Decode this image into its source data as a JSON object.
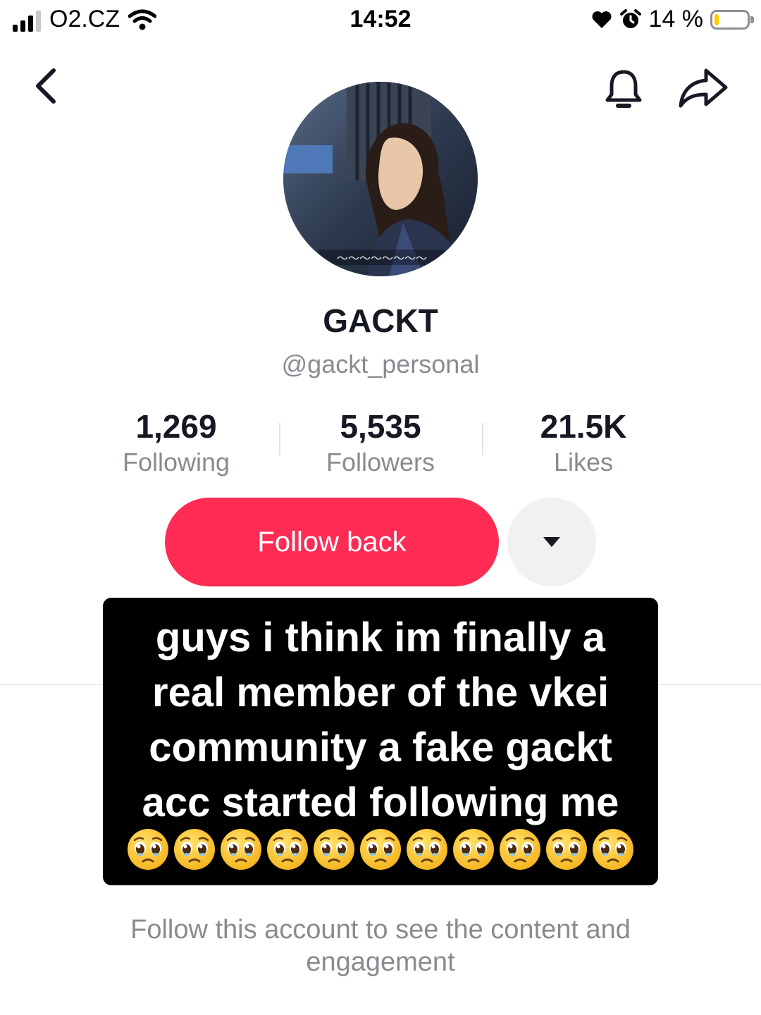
{
  "status_bar": {
    "carrier": "O2.CZ",
    "time": "14:52",
    "battery_percent": "14 %",
    "battery_level": 0.14,
    "icons": [
      "signal-icon",
      "wifi-icon",
      "heart-icon",
      "alarm-icon",
      "battery-icon"
    ]
  },
  "nav": {
    "back_icon": "chevron-left-icon",
    "bell_icon": "bell-icon",
    "share_icon": "share-arrow-icon"
  },
  "profile": {
    "display_name": "GACKT",
    "username": "@gackt_personal"
  },
  "stats": [
    {
      "value": "1,269",
      "label": "Following"
    },
    {
      "value": "5,535",
      "label": "Followers"
    },
    {
      "value": "21.5K",
      "label": "Likes"
    }
  ],
  "actions": {
    "follow_label": "Follow back",
    "more_icon": "caret-down-icon"
  },
  "caption": {
    "line1": "guys i think im finally a",
    "line2": "real member of the vkei",
    "line3": "community a fake gackt",
    "line4": "acc started following me",
    "emoji_name": "pleading-face-emoji",
    "emoji_count": 11
  },
  "locked_message": "Follow this account to see the content and engagement",
  "colors": {
    "accent": "#fe2c55",
    "muted_text": "#8a8b91",
    "primary_text": "#161823"
  }
}
